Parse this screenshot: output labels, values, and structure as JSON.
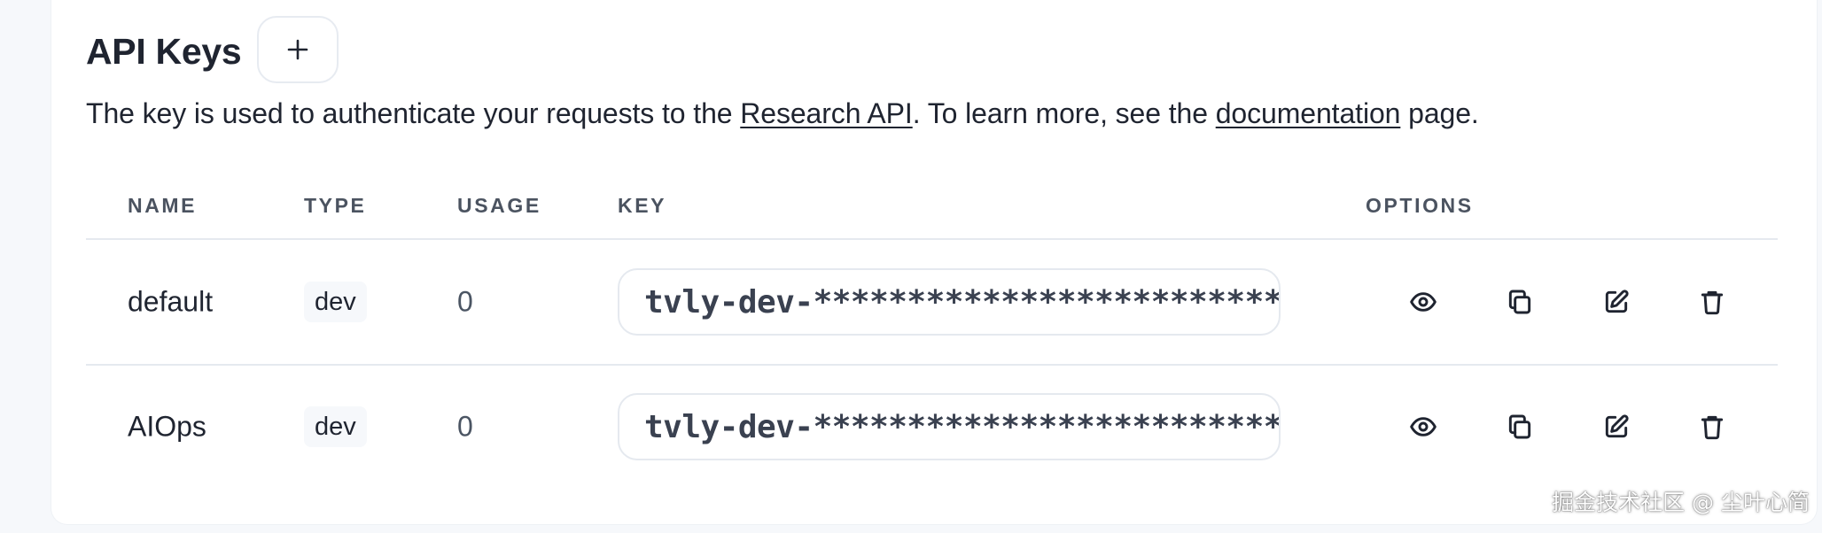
{
  "header": {
    "title": "API Keys",
    "add_button_icon": "plus-icon"
  },
  "description": {
    "prefix": "The key is used to authenticate your requests to the ",
    "link1": "Research API",
    "middle": ". To learn more, see the ",
    "link2": "documentation",
    "suffix": " page."
  },
  "table": {
    "columns": {
      "name": "NAME",
      "type": "TYPE",
      "usage": "USAGE",
      "key": "KEY",
      "options": "OPTIONS"
    },
    "rows": [
      {
        "name": "default",
        "type": "dev",
        "usage": "0",
        "key": "tvly-dev-********************************"
      },
      {
        "name": "AIOps",
        "type": "dev",
        "usage": "0",
        "key": "tvly-dev-********************************"
      }
    ],
    "option_icons": [
      "eye-icon",
      "copy-icon",
      "edit-icon",
      "trash-icon"
    ]
  },
  "watermark": "掘金技术社区 @ 尘叶心简",
  "colors": {
    "text": "#1f2430",
    "border": "#e5e9ef",
    "background": "#f6f8fb"
  }
}
